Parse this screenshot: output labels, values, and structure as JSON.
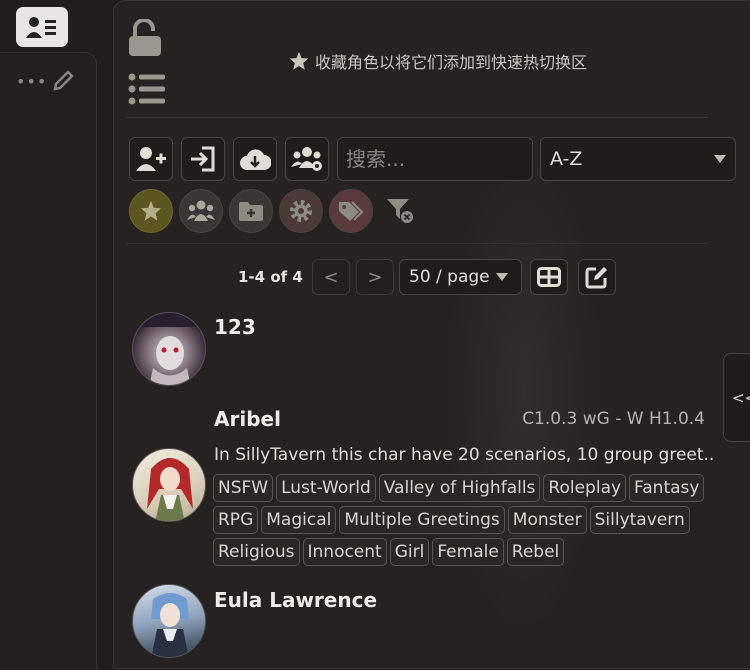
{
  "topbar": {
    "character_button_icon": "id-card-icon"
  },
  "left_panel": {
    "more_icon": "ellipsis-icon",
    "edit_icon": "pencil-icon"
  },
  "panel": {
    "lock_icon": "unlock-icon",
    "list_icon": "list-icon",
    "favorites_hint": "收藏角色以将它们添加到快速热切换区",
    "toolbar": {
      "buttons": [
        "add-character-icon",
        "import-icon",
        "download-cloud-icon",
        "create-group-icon"
      ],
      "search_placeholder": "搜索...",
      "sort_value": "A-Z"
    },
    "filters": [
      "star-icon",
      "users-icon",
      "folder-plus-icon",
      "gear-icon",
      "tags-icon",
      "filter-clear-icon"
    ],
    "pagination": {
      "range": "1-4 of 4",
      "prev": "<",
      "next": ">",
      "per_page": "50 / page"
    }
  },
  "characters": [
    {
      "name": "123"
    },
    {
      "name": "Aribel",
      "version": "C1.0.3 wG - W H1.0.4",
      "description": "In SillyTavern this char have 20 scenarios, 10 group greet...",
      "tags": [
        "NSFW",
        "Lust-World",
        "Valley of Highfalls",
        "Roleplay",
        "Fantasy",
        "RPG",
        "Magical",
        "Multiple Greetings",
        "Monster",
        "Sillytavern",
        "Religious",
        "Innocent",
        "Girl",
        "Female",
        "Rebel"
      ]
    },
    {
      "name": "Eula Lawrence"
    }
  ],
  "side_tab": {
    "label": "<<"
  },
  "colors": {
    "panel_bg": "#262222",
    "favorite_filter": "#5b5520",
    "border": "#4a4545"
  }
}
